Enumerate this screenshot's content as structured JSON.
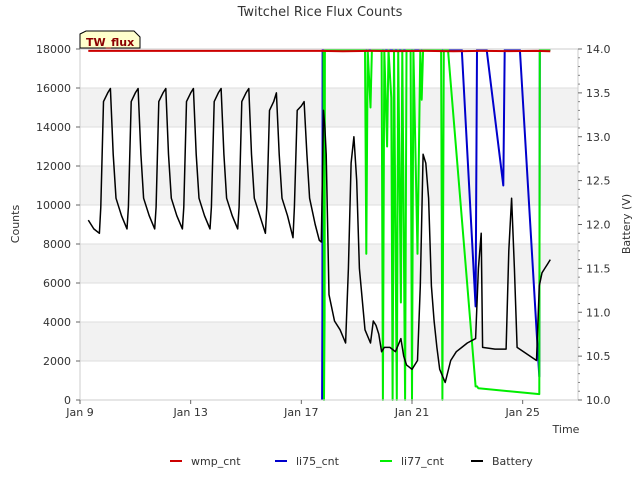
{
  "chart_data": {
    "type": "line",
    "title": "Twitchel Rice Flux Counts",
    "badge": "TW_flux",
    "xlabel": "Time",
    "ylabel_left": "Counts",
    "ylabel_right": "Battery (V)",
    "xlim": [
      0,
      18
    ],
    "ylim_left": [
      0,
      18000
    ],
    "ylim_right": [
      10.0,
      14.0
    ],
    "x_ticks": [
      {
        "value": 0,
        "label": "Jan 9"
      },
      {
        "value": 4,
        "label": "Jan 13"
      },
      {
        "value": 8,
        "label": "Jan 17"
      },
      {
        "value": 12,
        "label": "Jan 21"
      },
      {
        "value": 16,
        "label": "Jan 25"
      }
    ],
    "y_ticks_left": [
      {
        "value": 0,
        "label": "0"
      },
      {
        "value": 2000,
        "label": "2000"
      },
      {
        "value": 4000,
        "label": "4000"
      },
      {
        "value": 6000,
        "label": "6000"
      },
      {
        "value": 8000,
        "label": "8000"
      },
      {
        "value": 10000,
        "label": "10000"
      },
      {
        "value": 12000,
        "label": "12000"
      },
      {
        "value": 14000,
        "label": "14000"
      },
      {
        "value": 16000,
        "label": "16000"
      },
      {
        "value": 18000,
        "label": "18000"
      }
    ],
    "y_ticks_right": [
      {
        "value": 10.0,
        "label": "10.0"
      },
      {
        "value": 10.5,
        "label": "10.5"
      },
      {
        "value": 11.0,
        "label": "11.0"
      },
      {
        "value": 11.5,
        "label": "11.5"
      },
      {
        "value": 12.0,
        "label": "12.0"
      },
      {
        "value": 12.5,
        "label": "12.5"
      },
      {
        "value": 13.0,
        "label": "13.0"
      },
      {
        "value": 13.5,
        "label": "13.5"
      },
      {
        "value": 14.0,
        "label": "14.0"
      }
    ],
    "grid": true,
    "legend_position": "bottom-center",
    "series": [
      {
        "name": "wmp_cnt",
        "color": "#cc0000",
        "axis": "left",
        "points": [
          [
            0.3,
            17900
          ],
          [
            8.7,
            17900
          ],
          [
            9.5,
            17880
          ],
          [
            10.5,
            17900
          ],
          [
            11.5,
            17890
          ],
          [
            12.5,
            17900
          ],
          [
            13.5,
            17880
          ],
          [
            14.5,
            17900
          ],
          [
            15.5,
            17890
          ],
          [
            16.5,
            17900
          ],
          [
            17.0,
            17880
          ]
        ]
      },
      {
        "name": "li75_cnt",
        "color": "#0000cc",
        "axis": "left",
        "points": [
          [
            8.75,
            0
          ],
          [
            8.76,
            4300
          ],
          [
            8.77,
            17950
          ],
          [
            13.8,
            17950
          ],
          [
            14.3,
            4800
          ],
          [
            14.35,
            17950
          ],
          [
            14.7,
            17950
          ],
          [
            15.3,
            11000
          ],
          [
            15.35,
            17950
          ],
          [
            15.9,
            17950
          ],
          [
            16.6,
            1200
          ],
          [
            16.62,
            17950
          ],
          [
            17.0,
            17950
          ]
        ]
      },
      {
        "name": "li77_cnt",
        "color": "#00ee00",
        "axis": "left",
        "points": [
          [
            8.8,
            17950
          ],
          [
            8.82,
            0
          ],
          [
            8.84,
            4300
          ],
          [
            8.85,
            17950
          ],
          [
            10.3,
            17950
          ],
          [
            10.35,
            7500
          ],
          [
            10.4,
            17950
          ],
          [
            10.5,
            15000
          ],
          [
            10.55,
            17950
          ],
          [
            10.9,
            17950
          ],
          [
            10.95,
            0
          ],
          [
            11.0,
            17950
          ],
          [
            11.1,
            13000
          ],
          [
            11.15,
            17950
          ],
          [
            11.25,
            15500
          ],
          [
            11.3,
            0
          ],
          [
            11.35,
            17950
          ],
          [
            11.45,
            0
          ],
          [
            11.5,
            17950
          ],
          [
            11.6,
            5000
          ],
          [
            11.65,
            17950
          ],
          [
            11.75,
            0
          ],
          [
            11.8,
            17950
          ],
          [
            11.95,
            17950
          ],
          [
            12.0,
            0
          ],
          [
            12.05,
            17950
          ],
          [
            12.2,
            7500
          ],
          [
            12.3,
            17950
          ],
          [
            12.35,
            15400
          ],
          [
            12.4,
            17950
          ],
          [
            13.05,
            17950
          ],
          [
            13.1,
            0
          ],
          [
            13.15,
            17950
          ],
          [
            13.3,
            17950
          ],
          [
            14.3,
            700
          ],
          [
            14.35,
            700
          ],
          [
            14.4,
            600
          ],
          [
            16.6,
            300
          ],
          [
            16.62,
            17950
          ],
          [
            17.0,
            17950
          ]
        ]
      },
      {
        "name": "Battery",
        "color": "#000000",
        "axis": "right",
        "points": [
          [
            0.3,
            12.05
          ],
          [
            0.5,
            11.95
          ],
          [
            0.7,
            11.9
          ],
          [
            0.75,
            12.2
          ],
          [
            0.85,
            13.4
          ],
          [
            1.0,
            13.5
          ],
          [
            1.1,
            13.55
          ],
          [
            1.2,
            12.8
          ],
          [
            1.3,
            12.3
          ],
          [
            1.5,
            12.1
          ],
          [
            1.7,
            11.95
          ],
          [
            1.75,
            12.2
          ],
          [
            1.85,
            13.4
          ],
          [
            2.0,
            13.5
          ],
          [
            2.1,
            13.55
          ],
          [
            2.2,
            12.8
          ],
          [
            2.3,
            12.3
          ],
          [
            2.5,
            12.1
          ],
          [
            2.7,
            11.95
          ],
          [
            2.75,
            12.2
          ],
          [
            2.85,
            13.4
          ],
          [
            3.0,
            13.5
          ],
          [
            3.1,
            13.55
          ],
          [
            3.2,
            12.8
          ],
          [
            3.3,
            12.3
          ],
          [
            3.5,
            12.1
          ],
          [
            3.7,
            11.95
          ],
          [
            3.75,
            12.2
          ],
          [
            3.85,
            13.4
          ],
          [
            4.0,
            13.5
          ],
          [
            4.1,
            13.55
          ],
          [
            4.2,
            12.8
          ],
          [
            4.3,
            12.3
          ],
          [
            4.5,
            12.1
          ],
          [
            4.7,
            11.95
          ],
          [
            4.75,
            12.2
          ],
          [
            4.85,
            13.4
          ],
          [
            5.0,
            13.5
          ],
          [
            5.1,
            13.55
          ],
          [
            5.2,
            12.8
          ],
          [
            5.3,
            12.3
          ],
          [
            5.5,
            12.1
          ],
          [
            5.7,
            11.95
          ],
          [
            5.75,
            12.2
          ],
          [
            5.85,
            13.4
          ],
          [
            6.0,
            13.5
          ],
          [
            6.1,
            13.55
          ],
          [
            6.2,
            12.8
          ],
          [
            6.3,
            12.3
          ],
          [
            6.5,
            12.1
          ],
          [
            6.7,
            11.9
          ],
          [
            6.75,
            12.2
          ],
          [
            6.85,
            13.3
          ],
          [
            7.0,
            13.4
          ],
          [
            7.1,
            13.5
          ],
          [
            7.2,
            12.8
          ],
          [
            7.3,
            12.3
          ],
          [
            7.5,
            12.1
          ],
          [
            7.7,
            11.85
          ],
          [
            7.75,
            12.2
          ],
          [
            7.85,
            13.3
          ],
          [
            8.0,
            13.35
          ],
          [
            8.1,
            13.4
          ],
          [
            8.2,
            12.8
          ],
          [
            8.3,
            12.3
          ],
          [
            8.5,
            12.0
          ],
          [
            8.65,
            11.82
          ],
          [
            8.72,
            11.8
          ],
          [
            8.8,
            13.3
          ],
          [
            8.85,
            13.1
          ],
          [
            8.9,
            12.8
          ],
          [
            9.0,
            11.2
          ],
          [
            9.2,
            10.9
          ],
          [
            9.4,
            10.8
          ],
          [
            9.6,
            10.65
          ],
          [
            9.7,
            11.5
          ],
          [
            9.8,
            12.7
          ],
          [
            9.9,
            13.0
          ],
          [
            10.0,
            12.5
          ],
          [
            10.1,
            11.5
          ],
          [
            10.3,
            10.8
          ],
          [
            10.5,
            10.65
          ],
          [
            10.6,
            10.9
          ],
          [
            10.7,
            10.85
          ],
          [
            10.8,
            10.75
          ],
          [
            10.9,
            10.55
          ],
          [
            11.0,
            10.6
          ],
          [
            11.2,
            10.6
          ],
          [
            11.4,
            10.55
          ],
          [
            11.6,
            10.7
          ],
          [
            11.7,
            10.5
          ],
          [
            11.8,
            10.4
          ],
          [
            12.0,
            10.35
          ],
          [
            12.2,
            10.45
          ],
          [
            12.3,
            11.3
          ],
          [
            12.4,
            12.8
          ],
          [
            12.5,
            12.7
          ],
          [
            12.6,
            12.3
          ],
          [
            12.7,
            11.3
          ],
          [
            12.8,
            10.9
          ],
          [
            12.9,
            10.6
          ],
          [
            13.0,
            10.35
          ],
          [
            13.2,
            10.2
          ],
          [
            13.4,
            10.45
          ],
          [
            13.6,
            10.55
          ],
          [
            13.8,
            10.6
          ],
          [
            14.0,
            10.65
          ],
          [
            14.3,
            10.7
          ],
          [
            14.4,
            11.5
          ],
          [
            14.5,
            11.9
          ],
          [
            14.55,
            10.6
          ],
          [
            15.0,
            10.58
          ],
          [
            15.4,
            10.58
          ],
          [
            15.5,
            11.7
          ],
          [
            15.6,
            12.3
          ],
          [
            15.7,
            11.5
          ],
          [
            15.8,
            10.6
          ],
          [
            16.5,
            10.45
          ],
          [
            16.6,
            11.3
          ],
          [
            16.7,
            11.45
          ],
          [
            16.8,
            11.5
          ],
          [
            16.9,
            11.55
          ],
          [
            17.0,
            11.6
          ]
        ]
      }
    ]
  }
}
